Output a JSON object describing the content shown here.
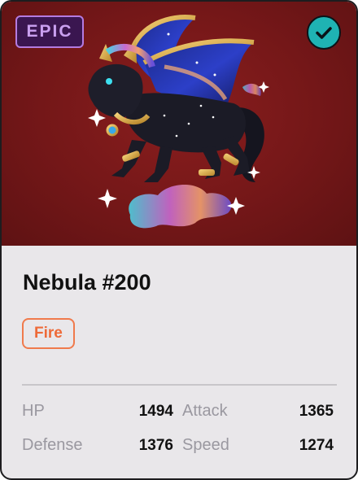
{
  "card": {
    "rarity": "EPIC",
    "verified_icon": "checkmark-icon",
    "name": "Nebula #200",
    "type": "Fire",
    "colors": {
      "background": "#7a1a1a",
      "rarity": "#b47be0",
      "verified": "#1fb3b3",
      "type": "#f07a4c"
    }
  },
  "stats": {
    "hp": {
      "label": "HP",
      "value": "1494"
    },
    "attack": {
      "label": "Attack",
      "value": "1365"
    },
    "defense": {
      "label": "Defense",
      "value": "1376"
    },
    "speed": {
      "label": "Speed",
      "value": "1274"
    }
  }
}
